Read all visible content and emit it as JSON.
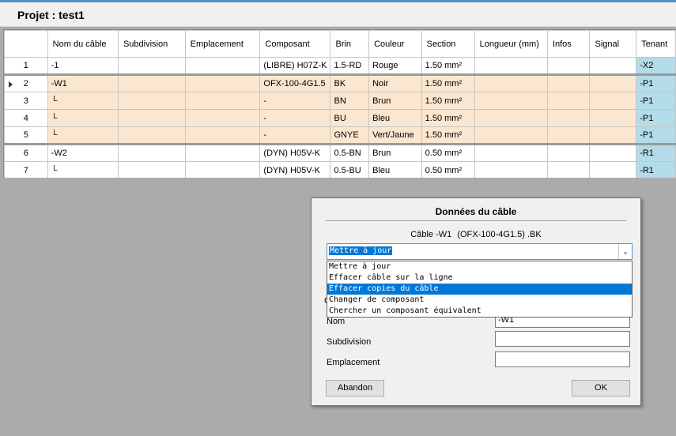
{
  "window": {
    "title": "Projet : test1"
  },
  "grid": {
    "columns": [
      "Nom du câble",
      "Subdivision",
      "Emplacement",
      "Composant",
      "Brin",
      "Couleur",
      "Section",
      "Longueur (mm)",
      "Infos",
      "Signal",
      "Tenant"
    ],
    "rows": [
      {
        "num": "1",
        "cable": "-1",
        "subdivision": "",
        "emplacement": "",
        "composant": "(LIBRE) H07Z-K",
        "brin": "1.5-RD",
        "couleur": "Rouge",
        "section": "1.50 mm²",
        "longueur": "",
        "infos": "",
        "signal": "",
        "tenant": "-X2"
      },
      {
        "num": "2",
        "cable": "-W1",
        "subdivision": "",
        "emplacement": "",
        "composant": "OFX-100-4G1.5",
        "brin": "BK",
        "couleur": "Noir",
        "section": "1.50 mm²",
        "longueur": "",
        "infos": "",
        "signal": "",
        "tenant": "-P1"
      },
      {
        "num": "3",
        "cable": "└",
        "subdivision": "",
        "emplacement": "",
        "composant": "-",
        "brin": "BN",
        "couleur": "Brun",
        "section": "1.50 mm²",
        "longueur": "",
        "infos": "",
        "signal": "",
        "tenant": "-P1"
      },
      {
        "num": "4",
        "cable": "└",
        "subdivision": "",
        "emplacement": "",
        "composant": "-",
        "brin": "BU",
        "couleur": "Bleu",
        "section": "1.50 mm²",
        "longueur": "",
        "infos": "",
        "signal": "",
        "tenant": "-P1"
      },
      {
        "num": "5",
        "cable": "└",
        "subdivision": "",
        "emplacement": "",
        "composant": "-",
        "brin": "GNYE",
        "couleur": "Vert/Jaune",
        "section": "1.50 mm²",
        "longueur": "",
        "infos": "",
        "signal": "",
        "tenant": "-P1"
      },
      {
        "num": "6",
        "cable": "-W2",
        "subdivision": "",
        "emplacement": "",
        "composant": "(DYN) H05V-K",
        "brin": "0.5-BN",
        "couleur": "Brun",
        "section": "0.50 mm²",
        "longueur": "",
        "infos": "",
        "signal": "",
        "tenant": "-R1"
      },
      {
        "num": "7",
        "cable": "└",
        "subdivision": "",
        "emplacement": "",
        "composant": "(DYN) H05V-K",
        "brin": "0.5-BU",
        "couleur": "Bleu",
        "section": "0.50 mm²",
        "longueur": "",
        "infos": "",
        "signal": "",
        "tenant": "-R1"
      }
    ]
  },
  "dialog": {
    "title": "Données du câble",
    "info": {
      "label": "Câble -W1",
      "component": "(OFX-100-4G1.5) .BK"
    },
    "action_select": {
      "value": "Mettre à jour",
      "options": [
        "Mettre à jour",
        "Effacer câble sur la ligne",
        "Effacer copies du câble",
        "Changer de composant",
        "Chercher un composant équivalent"
      ]
    },
    "fields": {
      "hidden_label_char": "C",
      "nom_label": "Nom",
      "nom_value": "-W1",
      "subdivision_label": "Subdivision",
      "subdivision_value": "",
      "emplacement_label": "Emplacement",
      "emplacement_value": ""
    },
    "buttons": {
      "cancel": "Abandon",
      "ok": "OK"
    }
  },
  "colors": {
    "highlight_row": "#fbe6d0",
    "tenant_cell": "#b3dce8",
    "selection": "#0078d7"
  }
}
